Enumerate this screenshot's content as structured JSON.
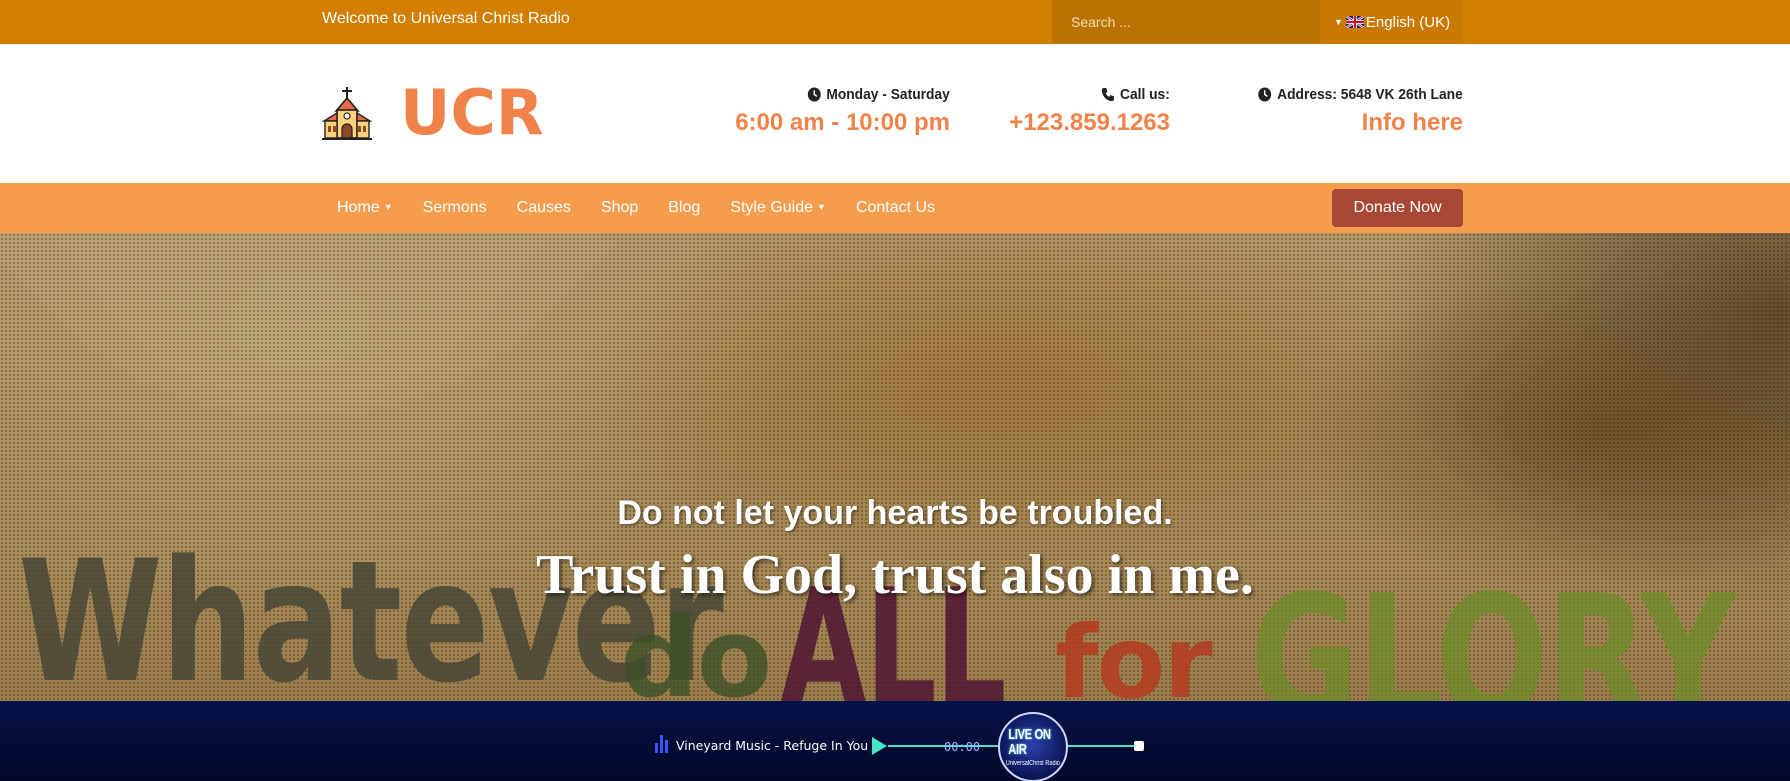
{
  "topbar": {
    "welcome": "Welcome to Universal Christ Radio",
    "search_placeholder": "Search ...",
    "language": "English (UK)"
  },
  "header": {
    "logo_text": "UCR",
    "hours_label": "Monday - Saturday",
    "hours_value": "6:00 am - 10:00 pm",
    "call_label": "Call us:",
    "call_value": "+123.859.1263",
    "address_label": "Address: 5648 VK 26th Lane",
    "address_value": "Info here"
  },
  "nav": {
    "items": [
      "Home",
      "Sermons",
      "Causes",
      "Shop",
      "Blog",
      "Style Guide",
      "Contact Us"
    ],
    "donate": "Donate Now"
  },
  "hero": {
    "line1": "Do not let your hearts be troubled.",
    "line2": "Trust in God, trust also in me.",
    "background_words": [
      "Whatever",
      "do",
      "ALL",
      "for",
      "GLORY"
    ]
  },
  "player": {
    "track": "Vineyard Music - Refuge In You",
    "time": "00:00",
    "badge_main": "LIVE ON AIR",
    "badge_sub": "UniversalChrist Radio"
  },
  "colors": {
    "topbar": "#d27f00",
    "accent": "#f0824a",
    "nav": "#f59d4d",
    "donate": "#a74836",
    "player": "#020726"
  },
  "icons": [
    "church-icon",
    "clock-icon",
    "phone-icon",
    "uk-flag-icon",
    "equalizer-icon",
    "play-icon"
  ]
}
